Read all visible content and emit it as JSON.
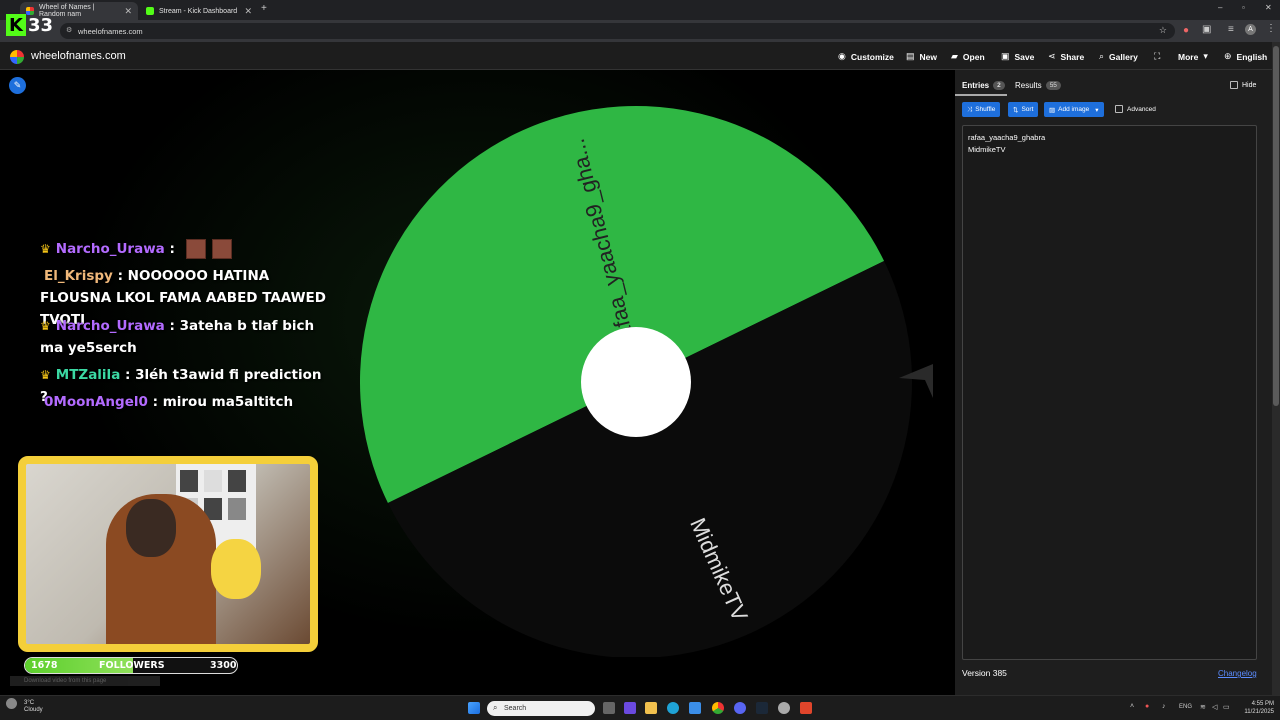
{
  "browser": {
    "tabs": [
      {
        "title": "Wheel of Names | Random nam",
        "active": true
      },
      {
        "title": "Stream - Kick Dashboard",
        "active": false
      }
    ],
    "url": "wheelofnames.com"
  },
  "kick_overlay": {
    "count": "33",
    "logo_letter": "K"
  },
  "site": {
    "name": "wheelofnames.com",
    "nav": {
      "customize": "Customize",
      "new": "New",
      "open": "Open",
      "save": "Save",
      "share": "Share",
      "gallery": "Gallery",
      "more": "More",
      "language": "English"
    }
  },
  "chat": {
    "messages": [
      {
        "user": "Narcho_Urawa",
        "text": "",
        "crown": true
      },
      {
        "user": "El_Krispy",
        "text": "NOOOOOO HATINA FLOUSNA LKOL FAMA AABED TAAWED TVOTI",
        "crown": false
      },
      {
        "user": "Narcho_Urawa",
        "text": "3ateha b tlaf bich ma ye5serch",
        "crown": true
      },
      {
        "user": "MTZalila",
        "text": "3léh t3awid fi prediction ?",
        "crown": true
      },
      {
        "user": "0MoonAngel0",
        "text": "mirou ma5altitch",
        "crown": false
      }
    ],
    "separator": ":"
  },
  "followers_goal": {
    "current": "1678",
    "label": "FOLLOWERS",
    "target": "3300",
    "progress": 0.508
  },
  "download_strip": "Download video from this page",
  "wheel": {
    "segments": [
      {
        "label": "rafaa_yaacha9_gha...",
        "color": "#2fb744"
      },
      {
        "label": "MidmikeTV",
        "color": "#0b0b0b"
      }
    ]
  },
  "panel": {
    "tab_entries": "Entries",
    "entries_count": "2",
    "tab_results": "Results",
    "results_count": "55",
    "hide_label": "Hide",
    "shuffle": "Shuffle",
    "sort": "Sort",
    "add_image": "Add image",
    "advanced": "Advanced",
    "entries": [
      "rafaa_yaacha9_ghabra",
      "MidmikeTV"
    ],
    "version": "Version 385",
    "changelog": "Changelog"
  },
  "taskbar": {
    "weather_temp": "3°C",
    "weather_desc": "Cloudy",
    "search_placeholder": "Search",
    "lang": "ENG",
    "time": "4:55 PM",
    "date": "11/21/2025"
  },
  "colors": {
    "accent_blue": "#1e6fdc",
    "wheel_green": "#2fb744",
    "kick_green": "#53fc18",
    "webcam_border": "#f4cf3a"
  }
}
